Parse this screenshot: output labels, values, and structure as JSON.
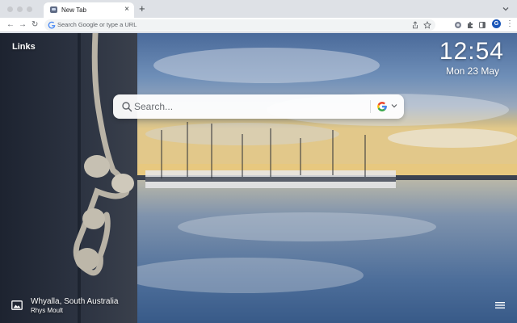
{
  "browser": {
    "tab": {
      "title": "New Tab",
      "close_glyph": "×"
    },
    "new_tab_glyph": "+",
    "nav": {
      "back": "←",
      "forward": "→",
      "reload": "↻"
    },
    "omnibox": {
      "placeholder": "Search Google or type a URL"
    },
    "profile_initial": "G",
    "menu_glyph": "⋮",
    "icons": [
      "google-g-icon",
      "share-icon",
      "bookmark-star-icon",
      "extension-icon",
      "puzzle-icon",
      "side-panel-icon"
    ]
  },
  "page": {
    "links_label": "Links",
    "clock": {
      "time": "12:54",
      "date": "Mon 23 May"
    },
    "search": {
      "placeholder": "Search...",
      "engine_icon": "google-logo-icon"
    },
    "photo": {
      "location": "Whyalla, South Australia",
      "author": "Rhys Moult"
    }
  },
  "colors": {
    "tabstrip": "#dee1e6",
    "profile": "#1a56b8",
    "google_blue": "#4285F4",
    "google_red": "#EA4335",
    "google_yellow": "#FBBC05",
    "google_green": "#34A853"
  }
}
